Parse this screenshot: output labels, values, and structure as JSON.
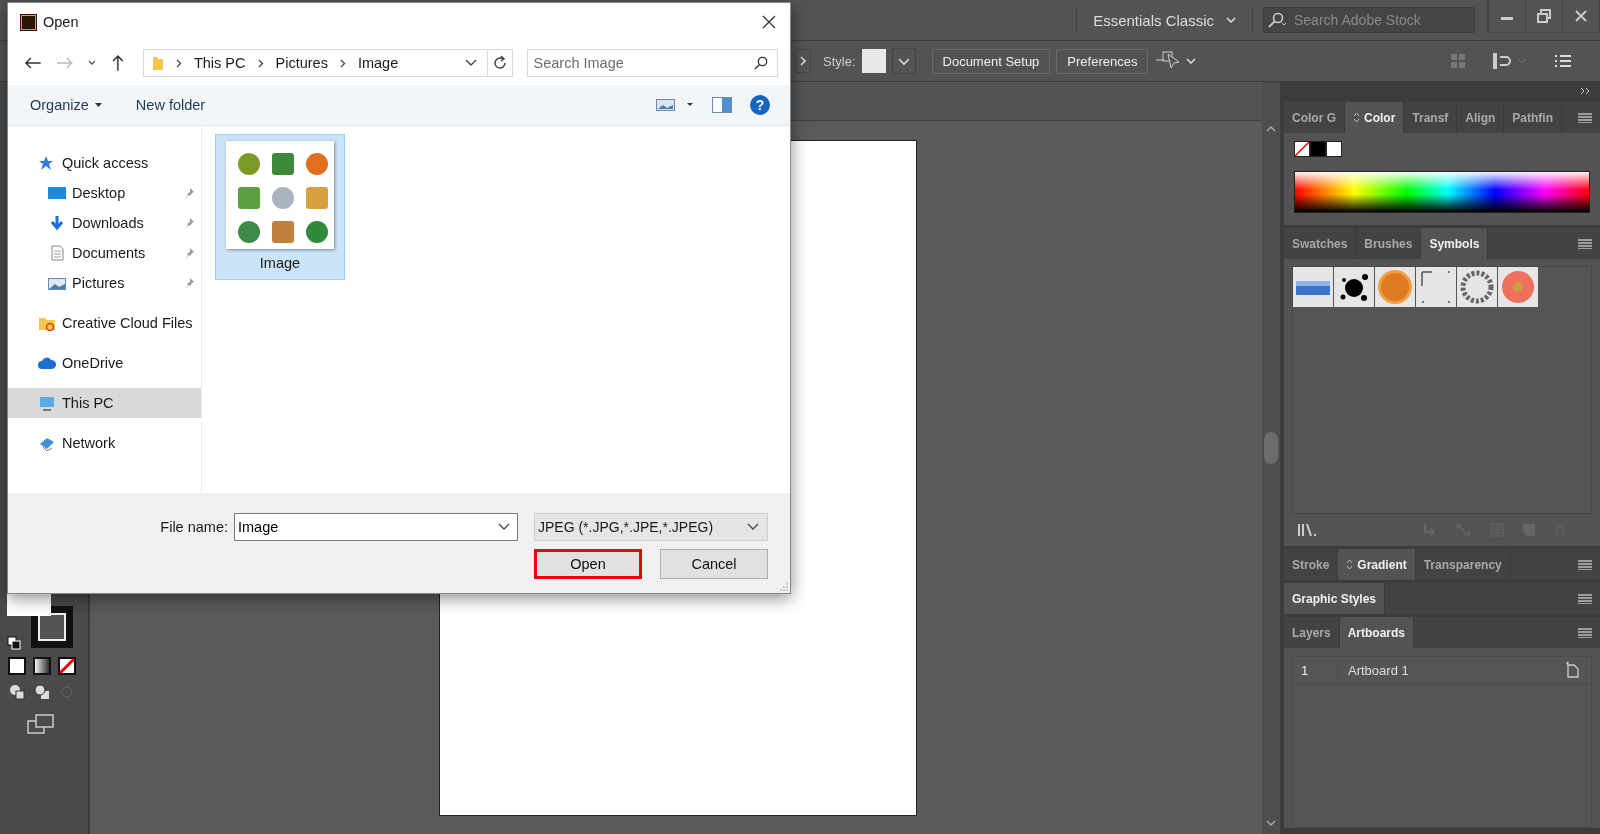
{
  "app": {
    "top_bar": {
      "workspace": "Essentials Classic",
      "search": {
        "placeholder": "Search Adobe Stock"
      }
    },
    "control_bar": {
      "style_label": "Style:",
      "buttons": [
        "Document Setup",
        "Preferences"
      ]
    },
    "panels": [
      {
        "kind": "color",
        "tabs": [
          {
            "label": "Color G",
            "selected": false,
            "toggle": false
          },
          {
            "label": "Color",
            "selected": true,
            "toggle": true
          },
          {
            "label": "Transf",
            "selected": false,
            "toggle": false
          },
          {
            "label": "Align",
            "selected": false,
            "toggle": false
          },
          {
            "label": "Pathfin",
            "selected": false,
            "toggle": false
          }
        ]
      },
      {
        "kind": "symbols",
        "tabs": [
          {
            "label": "Swatches",
            "selected": false,
            "toggle": false
          },
          {
            "label": "Brushes",
            "selected": false,
            "toggle": false
          },
          {
            "label": "Symbols",
            "selected": true,
            "toggle": false
          }
        ]
      },
      {
        "kind": "collapsed",
        "tabs": [
          {
            "label": "Stroke",
            "selected": false,
            "toggle": false
          },
          {
            "label": "Gradient",
            "selected": true,
            "toggle": true
          },
          {
            "label": "Transparency",
            "selected": false,
            "toggle": false
          }
        ]
      },
      {
        "kind": "collapsed",
        "tabs": [
          {
            "label": "Graphic Styles",
            "selected": true,
            "toggle": false
          }
        ]
      },
      {
        "kind": "artboards",
        "tabs": [
          {
            "label": "Layers",
            "selected": false,
            "toggle": false
          },
          {
            "label": "Artboards",
            "selected": true,
            "toggle": false
          }
        ],
        "rows": [
          {
            "number": "1",
            "name": "Artboard 1"
          }
        ]
      }
    ]
  },
  "dialog": {
    "title": "Open",
    "breadcrumb": [
      "This PC",
      "Pictures",
      "Image"
    ],
    "search": {
      "placeholder": "Search Image"
    },
    "help": "?",
    "commands": [
      {
        "label": "Organize",
        "menu": true
      },
      {
        "label": "New folder",
        "menu": false
      }
    ],
    "nav": [
      {
        "label": "Quick access",
        "kind": "star",
        "selected": false,
        "children": [
          {
            "label": "Desktop",
            "kind": "desktop",
            "pinned": true,
            "selected": false
          },
          {
            "label": "Downloads",
            "kind": "download",
            "pinned": true,
            "selected": false
          },
          {
            "label": "Documents",
            "kind": "document",
            "pinned": true,
            "selected": false
          },
          {
            "label": "Pictures",
            "kind": "pictures",
            "pinned": true,
            "selected": false
          }
        ]
      },
      {
        "label": "Creative Cloud Files",
        "kind": "cc",
        "selected": false
      },
      {
        "label": "OneDrive",
        "kind": "cloud",
        "selected": false
      },
      {
        "label": "This PC",
        "kind": "pc",
        "selected": true
      },
      {
        "label": "Network",
        "kind": "network",
        "selected": false
      }
    ],
    "files": [
      {
        "name": "Image",
        "selected": true
      }
    ],
    "file_name_label": "File name:",
    "file_name": "Image",
    "file_type": "JPEG (*.JPG,*.JPE,*.JPEG)",
    "buttons": [
      {
        "label": "Open",
        "highlighted": true
      },
      {
        "label": "Cancel",
        "highlighted": false
      }
    ]
  }
}
